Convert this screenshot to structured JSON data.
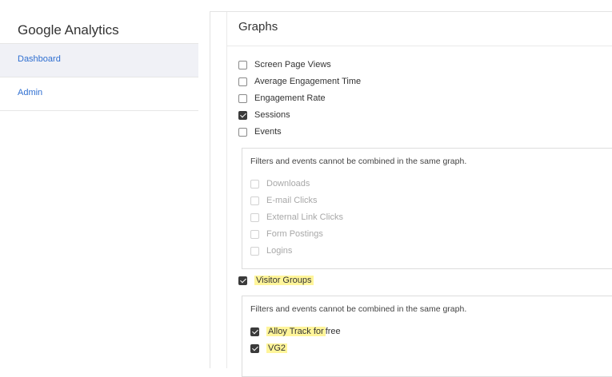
{
  "sidebar": {
    "title": "Google Analytics",
    "items": [
      {
        "label": "Dashboard"
      },
      {
        "label": "Admin"
      }
    ]
  },
  "graphs": {
    "title": "Graphs",
    "metrics": [
      {
        "label": "Screen Page Views",
        "checked": false
      },
      {
        "label": "Average Engagement Time",
        "checked": false
      },
      {
        "label": "Engagement Rate",
        "checked": false
      },
      {
        "label": "Sessions",
        "checked": true
      },
      {
        "label": "Events",
        "checked": false
      }
    ],
    "events_note": "Filters and events cannot be combined in the same graph.",
    "events": [
      {
        "label": "Downloads"
      },
      {
        "label": "E-mail Clicks"
      },
      {
        "label": "External Link Clicks"
      },
      {
        "label": "Form Postings"
      },
      {
        "label": "Logins"
      }
    ],
    "visitor_groups": {
      "label": "Visitor Groups",
      "checked": true
    },
    "groups_note": "Filters and events cannot be combined in the same graph.",
    "groups": [
      {
        "label_highlighted": "Alloy Track for",
        "label_rest": " free",
        "checked": true
      },
      {
        "label_highlighted": "VG2",
        "label_rest": "",
        "checked": true
      }
    ]
  },
  "colors": {
    "link": "#2f6fd1",
    "highlight": "#fff59a",
    "active_nav_bg": "#f0f1f6"
  }
}
